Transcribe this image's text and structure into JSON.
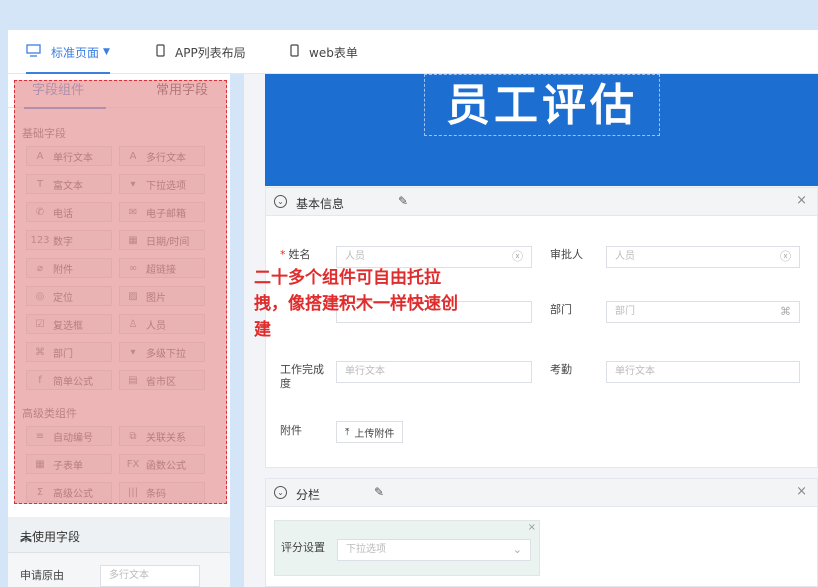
{
  "topbar": {
    "tabs": [
      {
        "label": "标准页面",
        "icon": "desktop-icon",
        "active": true
      },
      {
        "label": "APP列表布局",
        "icon": "mobile-icon"
      },
      {
        "label": "web表单",
        "icon": "mobile-icon"
      }
    ]
  },
  "left": {
    "tabs": [
      "字段组件",
      "常用字段"
    ],
    "basic_title": "基础字段",
    "basic": [
      {
        "icon": "A",
        "label": "单行文本"
      },
      {
        "icon": "A",
        "label": "多行文本"
      },
      {
        "icon": "T",
        "label": "富文本"
      },
      {
        "icon": "▾",
        "label": "下拉选项"
      },
      {
        "icon": "✆",
        "label": "电话"
      },
      {
        "icon": "✉",
        "label": "电子邮箱"
      },
      {
        "icon": "123",
        "label": "数字"
      },
      {
        "icon": "▦",
        "label": "日期/时间"
      },
      {
        "icon": "⌀",
        "label": "附件"
      },
      {
        "icon": "∞",
        "label": "超链接"
      },
      {
        "icon": "◎",
        "label": "定位"
      },
      {
        "icon": "▨",
        "label": "图片"
      },
      {
        "icon": "☑",
        "label": "复选框"
      },
      {
        "icon": "♙",
        "label": "人员"
      },
      {
        "icon": "⌘",
        "label": "部门"
      },
      {
        "icon": "▾",
        "label": "多级下拉"
      },
      {
        "icon": "f",
        "label": "简单公式"
      },
      {
        "icon": "▤",
        "label": "省市区"
      }
    ],
    "adv_title": "高级类组件",
    "advanced": [
      {
        "icon": "≡",
        "label": "自动编号"
      },
      {
        "icon": "⧉",
        "label": "关联关系"
      },
      {
        "icon": "▦",
        "label": "子表单"
      },
      {
        "icon": "FX",
        "label": "函数公式"
      },
      {
        "icon": "Σ",
        "label": "高级公式"
      },
      {
        "icon": "|||",
        "label": "条码"
      }
    ],
    "unused_title": "未使用字段",
    "unused_field": {
      "label": "申请原由",
      "placeholder": "多行文本"
    }
  },
  "canvas": {
    "banner_title": "员工评估",
    "section1": {
      "title": "基本信息",
      "fields": {
        "name": {
          "label": "姓名",
          "placeholder": "人员"
        },
        "approver": {
          "label": "审批人",
          "placeholder": "人员"
        },
        "dept": {
          "label": "部门",
          "placeholder": "部门"
        },
        "completion": {
          "label": "工作完成度",
          "placeholder": "单行文本"
        },
        "attendance": {
          "label": "考勤",
          "placeholder": "单行文本"
        },
        "attachment": {
          "label": "附件",
          "button": "上传附件"
        }
      }
    },
    "section2": {
      "title": "分栏",
      "rating": {
        "label": "评分设置",
        "placeholder": "下拉选项"
      }
    }
  },
  "promo": "二十多个组件可自由托拉拽，像搭建积木一样快速创建"
}
